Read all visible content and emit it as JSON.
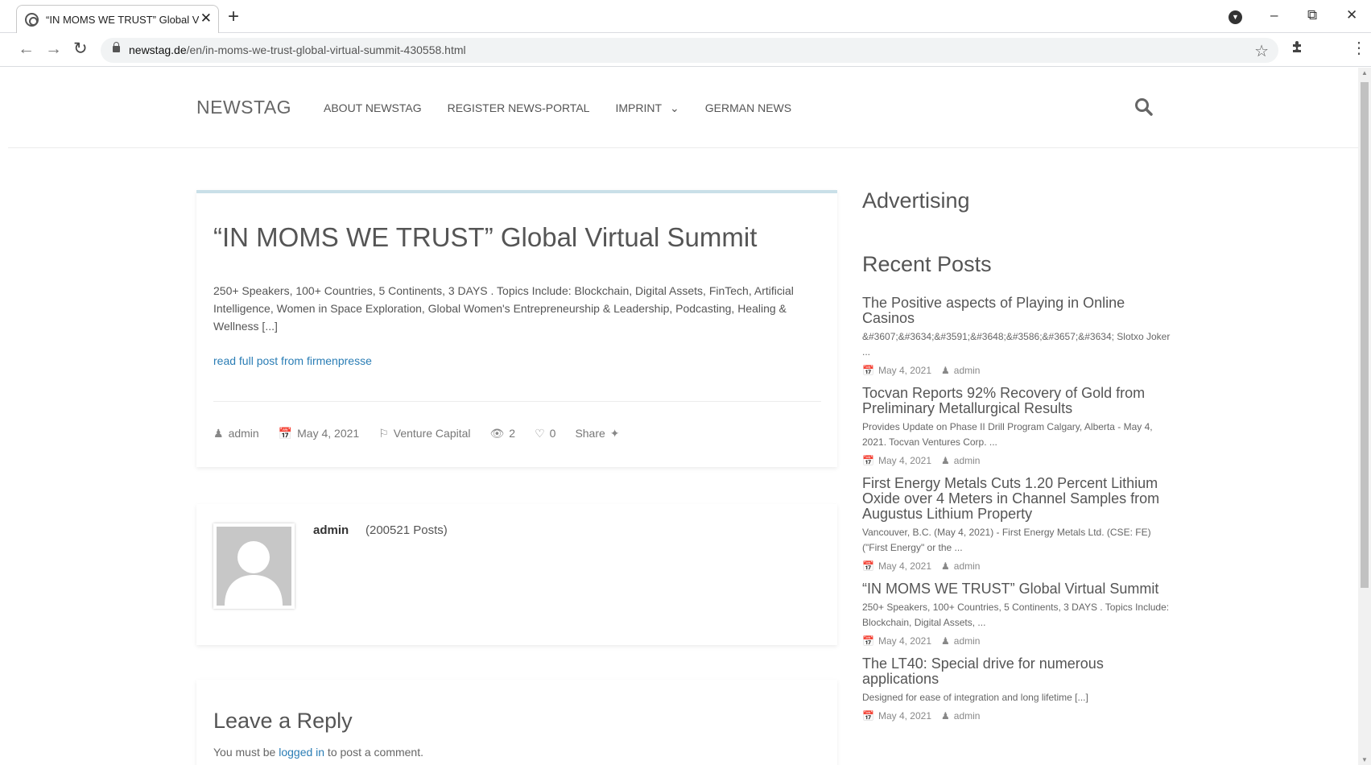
{
  "browser": {
    "tab_title": "“IN MOMS WE TRUST” Global Vir",
    "tab_close": "✕",
    "new_tab": "+",
    "url_host": "newstag.de",
    "url_path": "/en/in-moms-we-trust-global-virtual-summit-430558.html",
    "back_icon": "←",
    "forward_icon": "→",
    "reload_icon": "↻",
    "star_icon": "☆",
    "menu_icon": "⋮",
    "minimize": "–",
    "restore": "⧉",
    "close": "✕"
  },
  "site": {
    "logo": "NEWSTAG",
    "nav": [
      "ABOUT NEWSTAG",
      "REGISTER NEWS-PORTAL",
      "IMPRINT",
      "GERMAN NEWS"
    ],
    "nav_chevron": "⌄"
  },
  "post": {
    "title": "“IN MOMS WE TRUST” Global Virtual Summit",
    "excerpt": "250+ Speakers, 100+ Countries, 5 Continents, 3 DAYS . Topics Include: Blockchain, Digital Assets, FinTech, Artificial Intelligence, Women in Space Exploration, Global Women's Entrepreneurship & Leadership, Podcasting, Healing & Wellness [...]",
    "read_more": "read full post from firmenpresse",
    "meta": {
      "author": "admin",
      "date": "May 4, 2021",
      "category": "Venture Capital",
      "views": "2",
      "likes": "0",
      "share": "Share"
    }
  },
  "author_box": {
    "name": "admin",
    "posts": "(200521 Posts)"
  },
  "reply": {
    "title": "Leave a Reply",
    "note_before": "You must be ",
    "note_link": "logged in",
    "note_after": " to post a comment."
  },
  "sidebar": {
    "advertising_title": "Advertising",
    "recent_title": "Recent Posts",
    "recent_posts": [
      {
        "title": "The Positive aspects of Playing in Online Casinos",
        "excerpt": "&#3607;&#3634;&#3591;&#3648;&#3586;&#3657;&#3634; Slotxo Joker ...",
        "date": "May 4, 2021",
        "author": "admin"
      },
      {
        "title": "Tocvan Reports 92% Recovery of Gold from Preliminary Metallurgical Results",
        "excerpt": "Provides Update on Phase II Drill Program Calgary, Alberta - May 4, 2021. Tocvan Ventures Corp. ...",
        "date": "May 4, 2021",
        "author": "admin"
      },
      {
        "title": "First Energy Metals Cuts 1.20 Percent Lithium Oxide over 4 Meters in Channel Samples from Augustus Lithium Property",
        "excerpt": "Vancouver, B.C. (May 4, 2021) - First Energy Metals Ltd. (CSE: FE) (\"First Energy\" or the ...",
        "date": "May 4, 2021",
        "author": "admin"
      },
      {
        "title": "“IN MOMS WE TRUST” Global Virtual Summit",
        "excerpt": "250+ Speakers, 100+ Countries, 5 Continents, 3 DAYS . Topics Include: Blockchain, Digital Assets, ...",
        "date": "May 4, 2021",
        "author": "admin"
      },
      {
        "title": "The LT40: Special drive for numerous applications",
        "excerpt": "Designed for ease of integration and long lifetime [...]",
        "date": "May 4, 2021",
        "author": "admin"
      }
    ]
  },
  "colors": {
    "accent_link": "#2a7db5",
    "card_top_border": "#c9dfe8",
    "text_muted": "#777777"
  }
}
